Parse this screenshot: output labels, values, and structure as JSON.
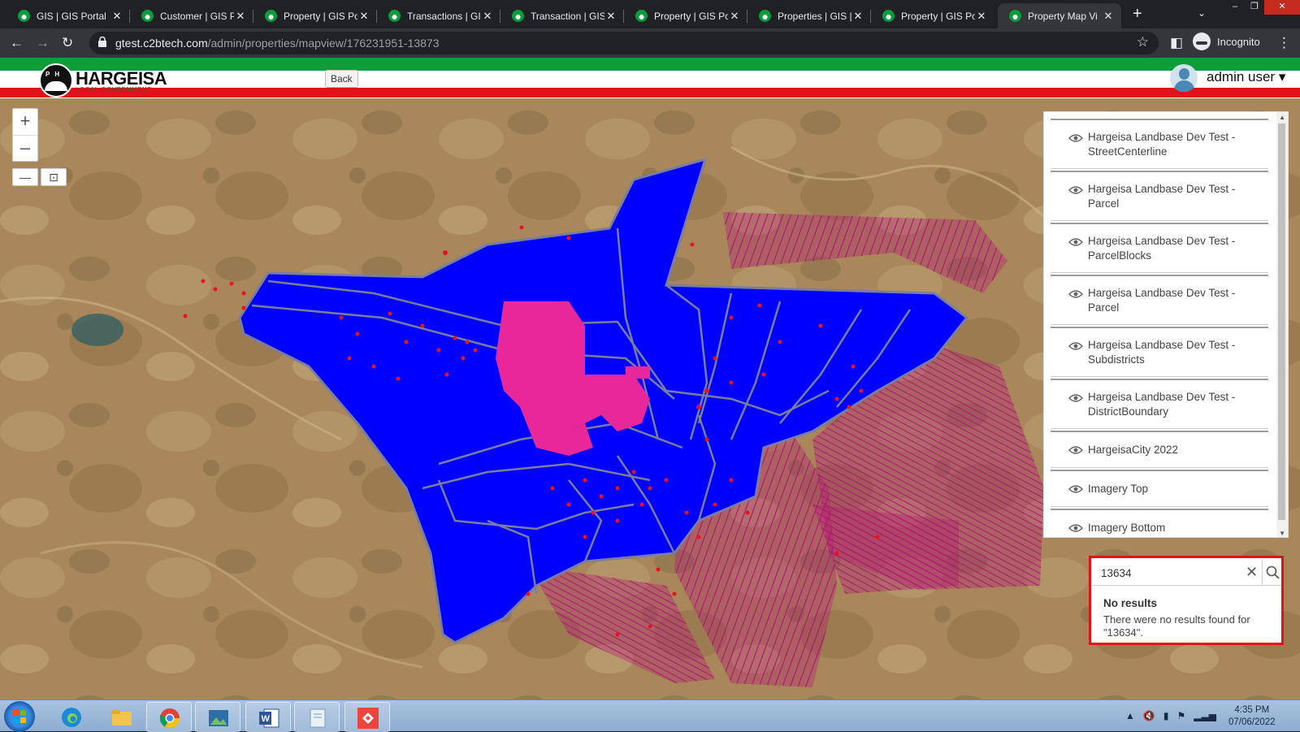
{
  "browser": {
    "tabs": [
      {
        "title": "GIS | GIS Portal",
        "active": false
      },
      {
        "title": "Customer | GIS P",
        "active": false
      },
      {
        "title": "Property | GIS Po",
        "active": false
      },
      {
        "title": "Transactions | GI:",
        "active": false
      },
      {
        "title": "Transaction | GIS",
        "active": false
      },
      {
        "title": "Property | GIS Pc",
        "active": false
      },
      {
        "title": "Properties | GIS |",
        "active": false
      },
      {
        "title": "Property | GIS Pc",
        "active": false
      },
      {
        "title": "Property Map Vi",
        "active": true
      }
    ],
    "new_tab": "+",
    "url_domain": "gtest.c2btech.com",
    "url_path": "/admin/properties/mapview/176231951-13873",
    "incognito_label": "Incognito"
  },
  "header": {
    "logo_initials": "P H",
    "logo_name": "HARGEISA",
    "logo_subtitle": "LOCAL GOVERNMENT",
    "back_label": "Back",
    "user_label": "admin user ▾"
  },
  "map": {
    "zoom_in": "+",
    "zoom_out": "–",
    "tool_1": "—",
    "tool_2": "⊡",
    "layers": [
      {
        "label": "Hargeisa Landbase Dev Test - StreetCenterline"
      },
      {
        "label": "Hargeisa Landbase Dev Test - Parcel"
      },
      {
        "label": "Hargeisa Landbase Dev Test - ParcelBlocks"
      },
      {
        "label": "Hargeisa Landbase Dev Test - Parcel"
      },
      {
        "label": "Hargeisa Landbase Dev Test - Subdistricts"
      },
      {
        "label": "Hargeisa Landbase Dev Test - DistrictBoundary"
      },
      {
        "label": "HargeisaCity 2022"
      },
      {
        "label": "Imagery Top"
      },
      {
        "label": "Imagery Bottom"
      }
    ],
    "search": {
      "value": "13634",
      "no_results_title": "No results",
      "no_results_message": "There were no results found for \"13634\"."
    },
    "colors": {
      "district_fill": "#0000ff",
      "subdistrict_line": "#7a7d9e",
      "parcels_pink": "#e8289a",
      "streets_magenta": "#a3156e",
      "points_red": "#e8141c"
    }
  },
  "taskbar": {
    "time": "4:35 PM",
    "date": "07/06/2022"
  }
}
